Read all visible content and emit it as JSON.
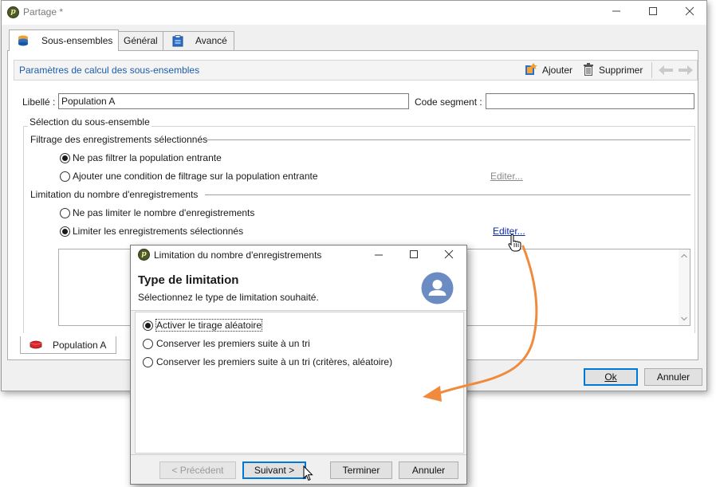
{
  "window": {
    "title": "Partage *"
  },
  "tabs": [
    {
      "label": "Sous-ensembles",
      "active": true
    },
    {
      "label": "Général",
      "active": false
    },
    {
      "label": "Avancé",
      "active": false
    }
  ],
  "section": {
    "title": "Paramètres de calcul des sous-ensembles",
    "add_label": "Ajouter",
    "delete_label": "Supprimer"
  },
  "form": {
    "libelle_label": "Libellé :",
    "libelle_value": "Population A",
    "code_segment_label": "Code segment :",
    "code_segment_value": ""
  },
  "selection": {
    "title": "Sélection du sous-ensemble",
    "filtering": {
      "title": "Filtrage des enregistrements sélectionnés",
      "options": [
        {
          "label": "Ne pas filtrer la population entrante",
          "selected": true
        },
        {
          "label": "Ajouter une condition de filtrage sur la population entrante",
          "selected": false
        }
      ],
      "edit_link": "Editer..."
    },
    "limitation": {
      "title": "Limitation du nombre d'enregistrements",
      "options": [
        {
          "label": "Ne pas limiter le nombre d'enregistrements",
          "selected": false
        },
        {
          "label": "Limiter les enregistrements sélectionnés",
          "selected": true
        }
      ],
      "edit_link": "Editer..."
    }
  },
  "bottom_tab": {
    "label": "Population A"
  },
  "main_buttons": {
    "ok": "Ok",
    "cancel": "Annuler"
  },
  "dialog": {
    "title": "Limitation du nombre d'enregistrements",
    "header_title": "Type de limitation",
    "header_subtitle": "Sélectionnez le type de limitation souhaité.",
    "options": [
      {
        "label": "Activer le tirage aléatoire",
        "selected": true
      },
      {
        "label": "Conserver les premiers suite à un tri",
        "selected": false
      },
      {
        "label": "Conserver les premiers suite à un tri (critères, aléatoire)",
        "selected": false
      }
    ],
    "buttons": {
      "previous": "< Précédent",
      "next": "Suivant >",
      "finish": "Terminer",
      "cancel": "Annuler"
    }
  },
  "colors": {
    "accent_arrow": "#f08a3c",
    "section_title": "#1f5ca8",
    "link": "#0b2aa8",
    "focus_border": "#0078d7"
  }
}
